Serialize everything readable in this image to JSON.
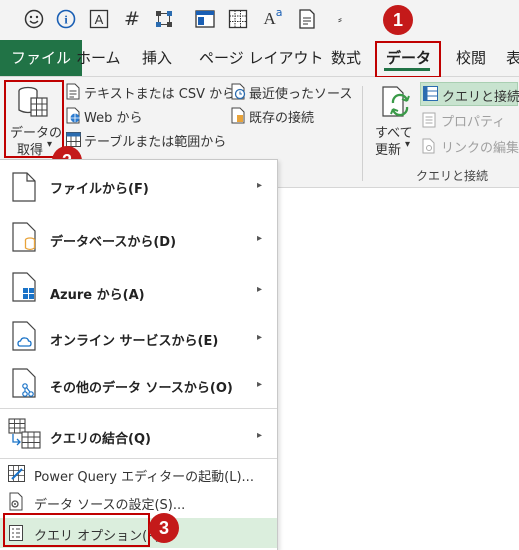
{
  "quick_access": {
    "icons": [
      "smiley-icon",
      "info-icon",
      "text-a-icon",
      "hash-icon",
      "grid-flow-icon",
      "window-icon",
      "table-icon",
      "superscript-icon",
      "form-icon",
      "customize-icon"
    ],
    "info_glyph": "i",
    "text_a_glyph": "A",
    "hash_glyph": "#",
    "superscript_base": "A",
    "superscript_sup": "a",
    "customize_glyph": "⸗"
  },
  "tabs": [
    {
      "label": "ファイル"
    },
    {
      "label": "ホーム"
    },
    {
      "label": "挿入"
    },
    {
      "label": "ページ レイアウト"
    },
    {
      "label": "数式"
    },
    {
      "label": "データ"
    },
    {
      "label": "校閲"
    },
    {
      "label": "表"
    }
  ],
  "ribbon": {
    "get_data": {
      "line1": "データの",
      "line2": "取得",
      "arrow": "▾"
    },
    "from_text_csv": "テキストまたは CSV から",
    "from_web": "Web から",
    "from_table": "テーブルまたは範囲から",
    "recent_sources": "最近使ったソース",
    "existing_connections": "既存の接続",
    "refresh_all": {
      "line1": "すべて",
      "line2": "更新",
      "arrow": "▾"
    },
    "queries_connections": "クエリと接続",
    "properties": "プロパティ",
    "edit_links": "リンクの編集",
    "group_label": "クエリと接続"
  },
  "menu": {
    "items": [
      {
        "label": "ファイルから(F)",
        "arrow": "▸"
      },
      {
        "label": "データベースから(D)",
        "arrow": "▸"
      },
      {
        "label": "Azure から(A)",
        "arrow": "▸"
      },
      {
        "label": "オンライン サービスから(E)",
        "arrow": "▸"
      },
      {
        "label": "その他のデータ ソースから(O)",
        "arrow": "▸"
      },
      {
        "label": "クエリの結合(Q)",
        "arrow": "▸"
      }
    ],
    "small_items": [
      {
        "label": "Power Query エディターの起動(L)..."
      },
      {
        "label": "データ ソースの設定(S)..."
      },
      {
        "label": "クエリ オプション(P)"
      }
    ]
  },
  "callouts": [
    "1",
    "2",
    "3"
  ],
  "colors": {
    "accent": "#217346",
    "callout": "#c41a1a",
    "highlight": "#c00000",
    "hover": "#dbeedd"
  }
}
